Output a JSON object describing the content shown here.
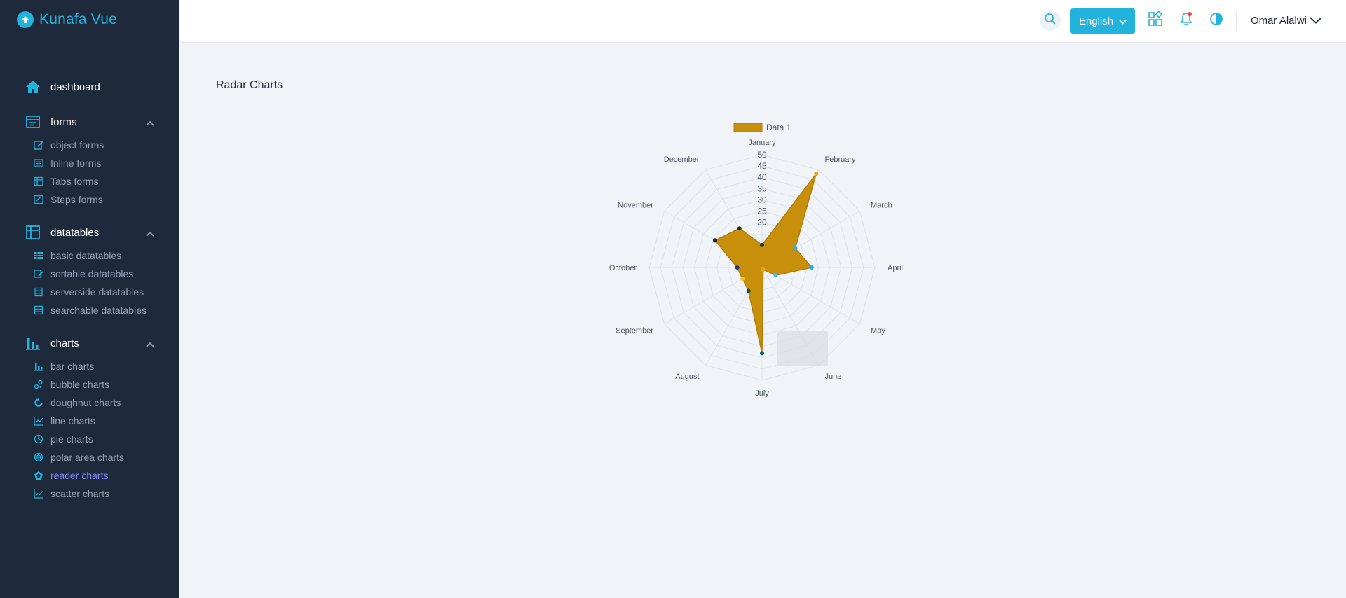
{
  "app": {
    "title": "Kunafa Vue"
  },
  "sidebar": {
    "dashboard": {
      "label": "dashboard"
    },
    "groups": [
      {
        "label": "forms",
        "items": [
          {
            "label": "object forms",
            "icon": "edit-icon"
          },
          {
            "label": "Inline forms",
            "icon": "list-icon"
          },
          {
            "label": "Tabs forms",
            "icon": "tabs-icon"
          },
          {
            "label": "Steps forms",
            "icon": "steps-icon"
          }
        ]
      },
      {
        "label": "datatables",
        "items": [
          {
            "label": "basic datatables",
            "icon": "grid-icon"
          },
          {
            "label": "sortable datatables",
            "icon": "sort-icon"
          },
          {
            "label": "serverside datatables",
            "icon": "server-icon"
          },
          {
            "label": "searchable datatables",
            "icon": "table-search-icon"
          }
        ]
      },
      {
        "label": "charts",
        "items": [
          {
            "label": "bar charts",
            "icon": "bar-chart-icon"
          },
          {
            "label": "bubble charts",
            "icon": "bubble-chart-icon"
          },
          {
            "label": "doughnut charts",
            "icon": "doughnut-chart-icon"
          },
          {
            "label": "line charts",
            "icon": "line-chart-icon"
          },
          {
            "label": "pie charts",
            "icon": "pie-chart-icon"
          },
          {
            "label": "polar area charts",
            "icon": "polar-chart-icon"
          },
          {
            "label": "reader charts",
            "icon": "radar-chart-icon",
            "active": true
          },
          {
            "label": "scatter charts",
            "icon": "scatter-chart-icon"
          }
        ]
      }
    ]
  },
  "header": {
    "language": "English",
    "user": "Omar Alalwi"
  },
  "main": {
    "title": "Radar Charts"
  },
  "colors": {
    "accent": "#22b3dd",
    "sidebar_bg": "#1e293b",
    "active_item": "#818cf8",
    "series_fill": "#c8900a",
    "notification_dot": "#ef4444"
  },
  "chart_data": {
    "type": "radar",
    "categories": [
      "January",
      "February",
      "March",
      "April",
      "May",
      "June",
      "July",
      "August",
      "September",
      "October",
      "November",
      "December"
    ],
    "series": [
      {
        "name": "Data 1",
        "values": [
          10,
          48,
          17,
          22,
          7,
          1,
          38,
          12,
          10,
          11,
          24,
          20
        ],
        "color": "#c8900a"
      }
    ],
    "point_colors": [
      "#1f2937",
      "#f59e0b",
      "#22b3dd",
      "#22b3dd",
      "#38bdf8",
      "#f59e0b",
      "#155e75",
      "#14532d",
      "#fbbf24",
      "#1e3a8a",
      "#111827",
      "#1f2937"
    ],
    "ticks": [
      20,
      25,
      30,
      35,
      40,
      45,
      50
    ],
    "rlim": [
      0,
      50
    ],
    "legend": "top"
  }
}
